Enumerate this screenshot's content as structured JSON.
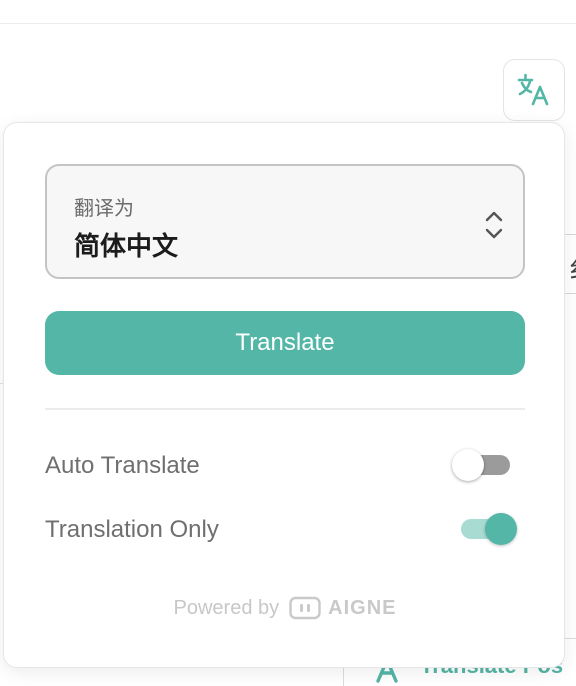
{
  "background": {
    "right_fragment": "纟",
    "bottom_button_label": "Translate Pos"
  },
  "trigger": {
    "icon": "translate-icon"
  },
  "popup": {
    "language_select": {
      "label": "翻译为",
      "value": "简体中文",
      "icon": "chevron-up-down-icon"
    },
    "translate_button": "Translate",
    "options": [
      {
        "label": "Auto Translate",
        "enabled": false
      },
      {
        "label": "Translation Only",
        "enabled": true
      }
    ],
    "footer": {
      "powered_by": "Powered by",
      "brand": "AIGNE",
      "icon": "aigne-logo-icon"
    }
  },
  "colors": {
    "accent": "#54b6a6",
    "accent_light": "#a8dcd2",
    "toggle_off": "#9b9b9b",
    "text_muted": "#6f6f6f"
  }
}
